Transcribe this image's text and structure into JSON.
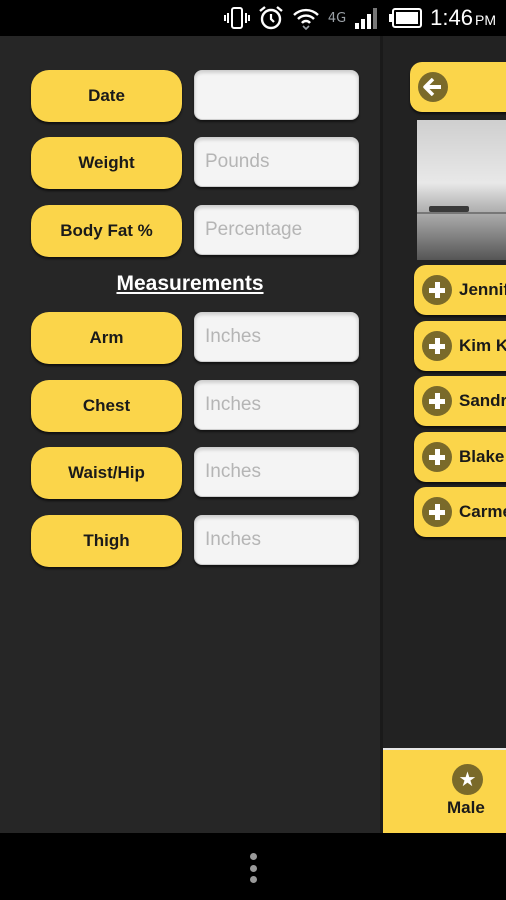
{
  "status_bar": {
    "time": "1:46",
    "ampm": "PM",
    "network": "4G",
    "icons": [
      "vibrate-icon",
      "alarm-icon",
      "wifi-icon",
      "signal-icon",
      "battery-icon"
    ]
  },
  "form": {
    "rows": [
      {
        "label": "Date",
        "value": "",
        "placeholder": ""
      },
      {
        "label": "Weight",
        "value": "",
        "placeholder": "Pounds"
      },
      {
        "label": "Body Fat %",
        "value": "",
        "placeholder": "Percentage"
      }
    ],
    "section_title": "Measurements",
    "measurements": [
      {
        "label": "Arm",
        "value": "",
        "placeholder": "Inches"
      },
      {
        "label": "Chest",
        "value": "",
        "placeholder": "Inches"
      },
      {
        "label": "Waist/Hip",
        "value": "",
        "placeholder": "Inches"
      },
      {
        "label": "Thigh",
        "value": "",
        "placeholder": "Inches"
      }
    ]
  },
  "drawer": {
    "back_icon": "arrow-left-icon",
    "items": [
      {
        "label": "Jennifer",
        "icon": "plus-icon"
      },
      {
        "label": "Kim K",
        "icon": "plus-icon"
      },
      {
        "label": "Sandra",
        "icon": "plus-icon"
      },
      {
        "label": "Blake",
        "icon": "plus-icon"
      },
      {
        "label": "Carmen",
        "icon": "plus-icon"
      }
    ],
    "tab": {
      "label": "Male",
      "icon": "star-icon"
    }
  },
  "colors": {
    "accent": "#fbd54a",
    "panel": "#262626",
    "icon_circle": "#7a6a2a"
  }
}
